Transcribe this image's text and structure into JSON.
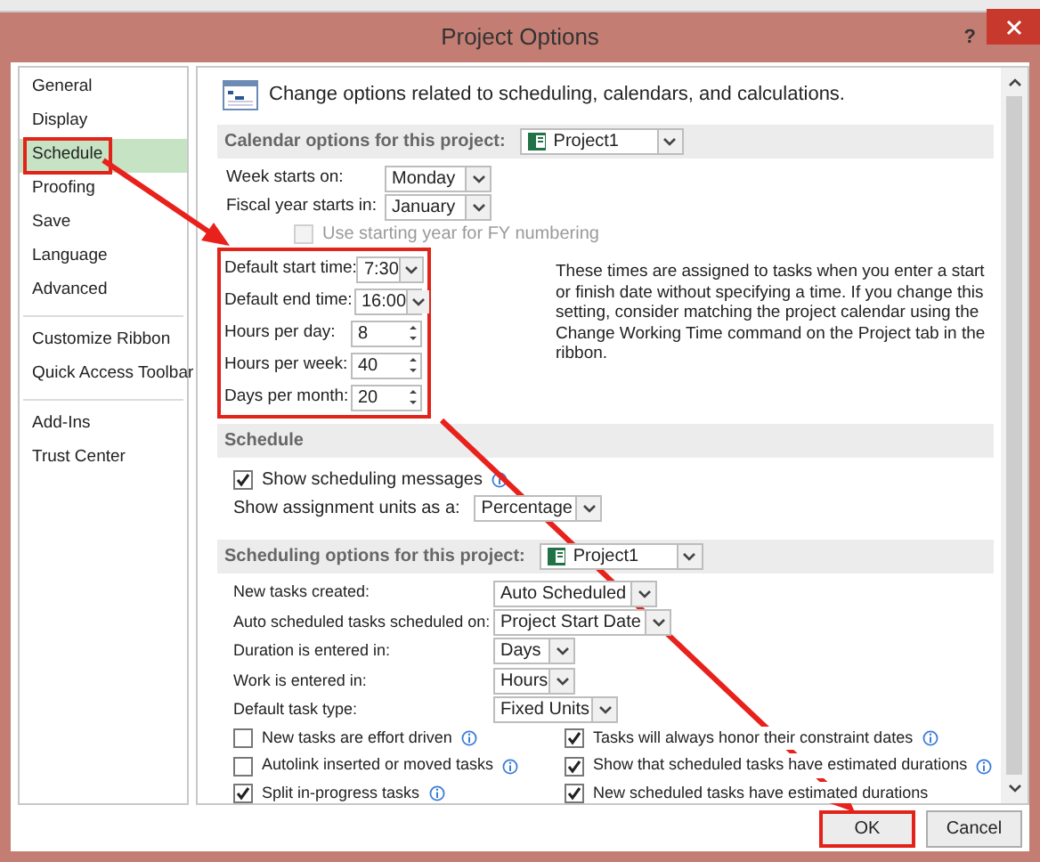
{
  "window": {
    "title": "Project Options",
    "help": "?"
  },
  "sidebar": {
    "groups": [
      [
        {
          "label": "General",
          "selected": false,
          "highlighted": false
        },
        {
          "label": "Display",
          "selected": false,
          "highlighted": false
        },
        {
          "label": "Schedule",
          "selected": true,
          "highlighted": true
        },
        {
          "label": "Proofing",
          "selected": false,
          "highlighted": false
        },
        {
          "label": "Save",
          "selected": false,
          "highlighted": false
        },
        {
          "label": "Language",
          "selected": false,
          "highlighted": false
        },
        {
          "label": "Advanced",
          "selected": false,
          "highlighted": false
        }
      ],
      [
        {
          "label": "Customize Ribbon",
          "selected": false,
          "highlighted": false
        },
        {
          "label": "Quick Access Toolbar",
          "selected": false,
          "highlighted": false
        }
      ],
      [
        {
          "label": "Add-Ins",
          "selected": false,
          "highlighted": false
        },
        {
          "label": "Trust Center",
          "selected": false,
          "highlighted": false
        }
      ]
    ]
  },
  "header": "Change options related to scheduling, calendars, and calculations.",
  "calendar_section": {
    "label": "Calendar options for this project:",
    "project": "Project1",
    "fields": [
      {
        "kind": "dropdown",
        "label": "Week starts on:",
        "value": "Monday"
      },
      {
        "kind": "dropdown",
        "label": "Fiscal year starts in:",
        "value": "January"
      }
    ],
    "fy_checkbox": {
      "label": "Use starting year for FY numbering",
      "checked": false,
      "disabled": true
    },
    "time_fields": {
      "highlighted": true,
      "fields": [
        {
          "kind": "dropdown",
          "label": "Default start time:",
          "value": "7:30"
        },
        {
          "kind": "dropdown",
          "label": "Default end time:",
          "value": "16:00"
        },
        {
          "kind": "spin",
          "label": "Hours per day:",
          "value": "8"
        },
        {
          "kind": "spin",
          "label": "Hours per week:",
          "value": "40"
        },
        {
          "kind": "spin",
          "label": "Days per month:",
          "value": "20"
        }
      ]
    },
    "note": "These times are assigned to tasks when you enter a start or finish date without specifying a time. If you change this setting, consider matching the project calendar using the Change Working Time command on the Project tab in the ribbon."
  },
  "schedule_section": {
    "label": "Schedule",
    "show_messages": {
      "label": "Show scheduling messages",
      "checked": true,
      "info": true
    },
    "assignment_units": {
      "label": "Show assignment units as a:",
      "value": "Percentage"
    }
  },
  "scheduling_options": {
    "label": "Scheduling options for this project:",
    "project": "Project1",
    "fields": [
      {
        "label": "New tasks created:",
        "value": "Auto Scheduled"
      },
      {
        "label": "Auto scheduled tasks scheduled on:",
        "value": "Project Start Date"
      },
      {
        "label": "Duration is entered in:",
        "value": "Days"
      },
      {
        "label": "Work is entered in:",
        "value": "Hours"
      },
      {
        "label": "Default task type:",
        "value": "Fixed Units"
      }
    ],
    "checkboxes": [
      {
        "label": "New tasks are effort driven",
        "checked": false,
        "info": true
      },
      {
        "label": "Tasks will always honor their constraint dates",
        "checked": true,
        "info": true
      },
      {
        "label": "Autolink inserted or moved tasks",
        "checked": false,
        "info": true
      },
      {
        "label": "Show that scheduled tasks have estimated durations",
        "checked": true,
        "info": true
      },
      {
        "label": "Split in-progress tasks",
        "checked": true,
        "info": true
      },
      {
        "label": "New scheduled tasks have estimated durations",
        "checked": true,
        "info": false
      }
    ]
  },
  "buttons": [
    {
      "label": "OK",
      "highlighted": true
    },
    {
      "label": "Cancel",
      "highlighted": false
    }
  ]
}
